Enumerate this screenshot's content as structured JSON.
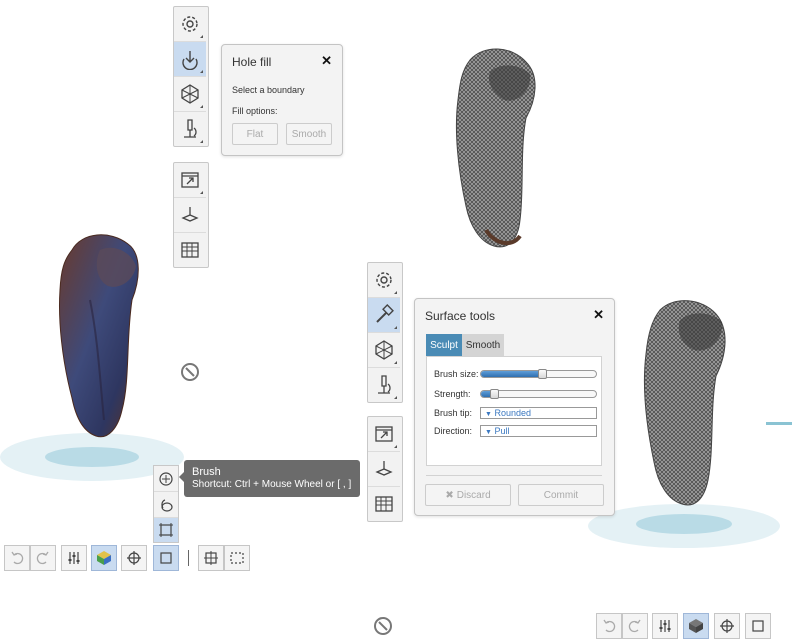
{
  "hole_fill": {
    "title": "Hole fill",
    "close": "✕",
    "prompt": "Select a boundary",
    "fill_options_label": "Fill options:",
    "flat_label": "Flat",
    "smooth_label": "Smooth"
  },
  "surface_tools": {
    "title": "Surface tools",
    "close": "✕",
    "tab_sculpt": "Sculpt",
    "tab_smooth": "Smooth",
    "brush_size_label": "Brush size:",
    "brush_size_value": 0.53,
    "strength_label": "Strength:",
    "strength_value": 0.12,
    "brush_tip_label": "Brush tip:",
    "brush_tip_value": "Rounded",
    "direction_label": "Direction:",
    "direction_value": "Pull",
    "discard_label": "Discard",
    "commit_label": "Commit"
  },
  "tooltip": {
    "title": "Brush",
    "shortcut": "Shortcut: Ctrl + Mouse Wheel or [ , ]"
  },
  "colors": {
    "accent": "#4a8bb5",
    "active_tool": "#c9dbf0",
    "platform": "#bde0ea",
    "tooltip_bg": "#6b6b6b"
  }
}
